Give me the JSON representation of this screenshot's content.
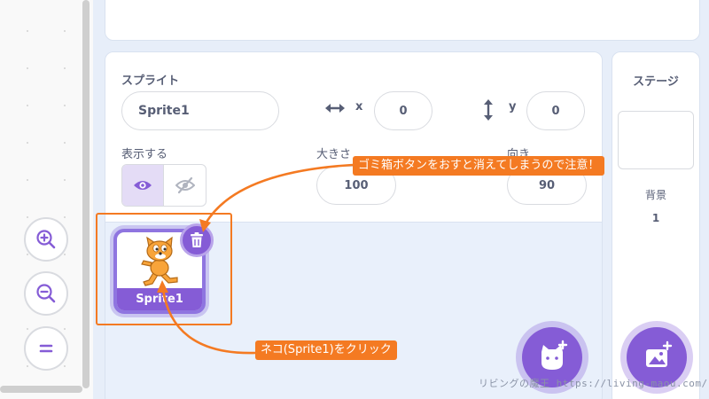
{
  "sprite_info": {
    "sprite_label": "スプライト",
    "sprite_name_value": "Sprite1",
    "x_label": "x",
    "x_value": "0",
    "y_label": "y",
    "y_value": "0",
    "show_label": "表示する",
    "size_label": "大きさ",
    "size_value": "100",
    "direction_label": "向き",
    "direction_value": "90"
  },
  "sprite_list": {
    "items": [
      {
        "name": "Sprite1"
      }
    ]
  },
  "stage_panel": {
    "title": "ステージ",
    "backdrop_label": "背景",
    "backdrop_count": "1"
  },
  "annotations": {
    "delete_warning": "ゴミ箱ボタンをおすと消えてしまうので注意！",
    "click_instruction": "ネコ(Sprite1)をクリック",
    "callout_color": "#f47a22"
  },
  "watermark": "リビングの魔王 https://living-maou.com/",
  "colors": {
    "accent": "#855cd6",
    "panel_bg": "#e9f0fb",
    "text": "#575e75"
  },
  "icons": [
    "zoom-in-icon",
    "zoom-out-icon",
    "zoom-reset-icon",
    "horizontal-arrows-icon",
    "vertical-arrows-icon",
    "eye-icon",
    "eye-slash-icon",
    "trash-icon",
    "cat-sprite-icon",
    "add-sprite-icon",
    "add-backdrop-icon"
  ]
}
